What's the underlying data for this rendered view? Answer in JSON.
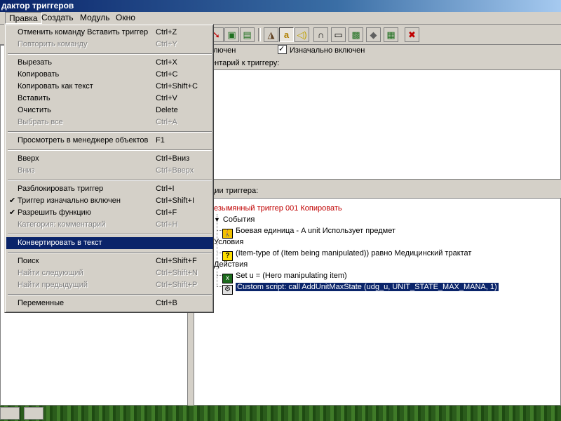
{
  "window": {
    "title": "дактор триггеров"
  },
  "menubar": {
    "items": [
      "Правка",
      "Создать",
      "Модуль",
      "Окно"
    ]
  },
  "toolbar": {
    "icons": [
      "arrow-icon",
      "map-paste-icon",
      "save-test-icon",
      "terrain-icon",
      "text-a-icon",
      "sound-icon",
      "headphones-icon",
      "object-icon",
      "unit-icon",
      "item-icon",
      "import-icon",
      "close-icon"
    ]
  },
  "trigger": {
    "enabled_label": "лючен",
    "initially_enabled_label": "Изначально включен",
    "comment_label": "ентарий к триггеру:",
    "functions_label": "ции триггера:",
    "name": "езымянный триггер 001 Копировать",
    "events_label": "События",
    "event_1": "Боевая единица - A unit Использует предмет",
    "conditions_label": "Условия",
    "condition_1": "(Item-type of (Item being manipulated)) равно Медицинский трактат",
    "actions_label": "Действия",
    "action_1": "Set u = (Hero manipulating item)",
    "action_2": "Custom script:   call AddUnitMaxState (udg_u, UNIT_STATE_MAX_MANA, 1)"
  },
  "dropdown": {
    "items": [
      {
        "label": "Отменить команду Вставить триггер",
        "shortcut": "Ctrl+Z"
      },
      {
        "label": "Повторить команду",
        "shortcut": "Ctrl+Y"
      },
      {
        "label": "Вырезать",
        "shortcut": "Ctrl+X"
      },
      {
        "label": "Копировать",
        "shortcut": "Ctrl+C"
      },
      {
        "label": "Копировать как текст",
        "shortcut": "Ctrl+Shift+C"
      },
      {
        "label": "Вставить",
        "shortcut": "Ctrl+V"
      },
      {
        "label": "Очистить",
        "shortcut": "Delete"
      },
      {
        "label": "Выбрать все",
        "shortcut": "Ctrl+A"
      },
      {
        "label": "Просмотреть в менеджере объектов",
        "shortcut": "F1"
      },
      {
        "label": "Вверх",
        "shortcut": "Ctrl+Вниз"
      },
      {
        "label": "Вниз",
        "shortcut": "Ctrl+Вверх"
      },
      {
        "label": "Разблокировать триггер",
        "shortcut": "Ctrl+I"
      },
      {
        "label": "Триггер изначально включен",
        "shortcut": "Ctrl+Shift+I",
        "checked": true
      },
      {
        "label": "Разрешить функцию",
        "shortcut": "Ctrl+F",
        "checked": true
      },
      {
        "label": "Категория: комментарий",
        "shortcut": "Ctrl+H"
      },
      {
        "label": "Конвертировать в текст",
        "shortcut": ""
      },
      {
        "label": "Поиск",
        "shortcut": "Ctrl+Shift+F"
      },
      {
        "label": "Найти следующий",
        "shortcut": "Ctrl+Shift+N"
      },
      {
        "label": "Найти предыдущий",
        "shortcut": "Ctrl+Shift+P"
      },
      {
        "label": "Переменные",
        "shortcut": "Ctrl+B"
      }
    ],
    "check_mark": "✔"
  },
  "colors": {
    "highlight": "#0a246a",
    "trigger_name": "#c00000",
    "face": "#d4d0c8"
  }
}
